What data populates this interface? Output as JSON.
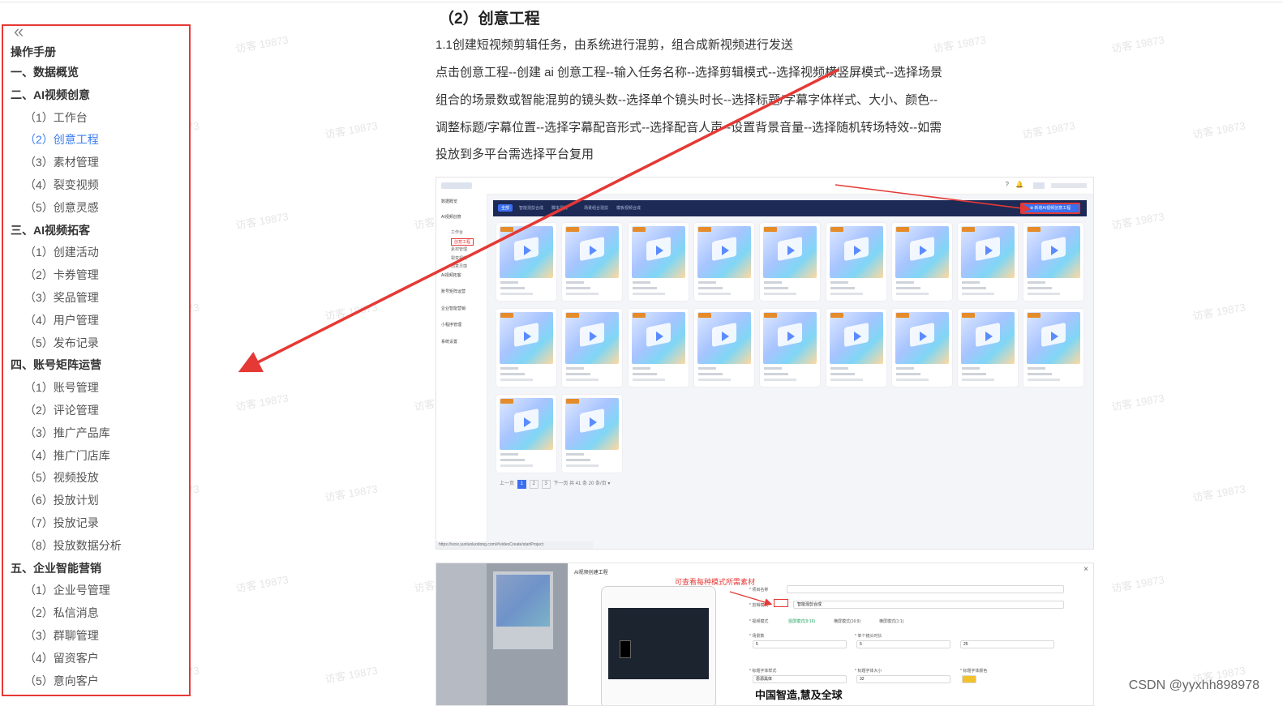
{
  "toc": {
    "collapse_glyph": "«",
    "title": "操作手册",
    "items": [
      {
        "label": "一、数据概览",
        "level": 1
      },
      {
        "label": "二、AI视频创意",
        "level": 1
      },
      {
        "label": "（1）工作台",
        "level": 2
      },
      {
        "label": "（2）创意工程",
        "level": 2,
        "active": true
      },
      {
        "label": "（3）素材管理",
        "level": 2
      },
      {
        "label": "（4）裂变视频",
        "level": 2
      },
      {
        "label": "（5）创意灵感",
        "level": 2
      },
      {
        "label": "三、AI视频拓客",
        "level": 1
      },
      {
        "label": "（1）创建活动",
        "level": 2
      },
      {
        "label": "（2）卡券管理",
        "level": 2
      },
      {
        "label": "（3）奖品管理",
        "level": 2
      },
      {
        "label": "（4）用户管理",
        "level": 2
      },
      {
        "label": "（5）发布记录",
        "level": 2
      },
      {
        "label": "四、账号矩阵运营",
        "level": 1
      },
      {
        "label": "（1）账号管理",
        "level": 2
      },
      {
        "label": "（2）评论管理",
        "level": 2
      },
      {
        "label": "（3）推广产品库",
        "level": 2
      },
      {
        "label": "（4）推广门店库",
        "level": 2
      },
      {
        "label": "（5）视频投放",
        "level": 2
      },
      {
        "label": "（6）投放计划",
        "level": 2
      },
      {
        "label": "（7）投放记录",
        "level": 2
      },
      {
        "label": "（8）投放数据分析",
        "level": 2
      },
      {
        "label": "五、企业智能营销",
        "level": 1
      },
      {
        "label": "（1）企业号管理",
        "level": 2
      },
      {
        "label": "（2）私信消息",
        "level": 2
      },
      {
        "label": "（3）群聊管理",
        "level": 2
      },
      {
        "label": "（4）留资客户",
        "level": 2
      },
      {
        "label": "（5）意向客户",
        "level": 2
      }
    ]
  },
  "article": {
    "heading": "（2）创意工程",
    "paragraphs": [
      "1.1创建短视频剪辑任务，由系统进行混剪，组合成新视频进行发送",
      "点击创意工程--创建 ai 创意工程--输入任务名称--选择剪辑模式--选择视频横竖屏模式--选择场景",
      "组合的场景数或智能混剪的镜头数--选择单个镜头时长--选择标题/字幕字体样式、大小、颜色--",
      "调整标题/字幕位置--选择字幕配音形式--选择配音人声--设置背景音量--选择随机转场特效--如需",
      "投放到多平台需选择平台复用"
    ]
  },
  "shot1": {
    "help_glyph": "?",
    "menu": [
      {
        "label": "数据概览",
        "sub": false
      },
      {
        "label": "AI视频创意",
        "sub": false
      },
      {
        "label": "工作台",
        "sub": true
      },
      {
        "label": "创意工程",
        "sub": true,
        "highlight": true
      },
      {
        "label": "素材管理",
        "sub": true
      },
      {
        "label": "裂变视频",
        "sub": true
      },
      {
        "label": "创意灵感",
        "sub": true
      },
      {
        "label": "AI视频拓客",
        "sub": false
      },
      {
        "label": "账号矩阵运营",
        "sub": false
      },
      {
        "label": "企业智能营销",
        "sub": false
      },
      {
        "label": "小程序管理",
        "sub": false
      },
      {
        "label": "系统设置",
        "sub": false
      }
    ],
    "tabs": [
      "全部",
      "智能混剪合成",
      "脚本混剪",
      "场景组合混剪",
      "模板视频合成"
    ],
    "create_button": "⊕ 新增AI视频创意工程",
    "pager": {
      "prev": "上一页",
      "pages": [
        "1",
        "2",
        "3"
      ],
      "next": "下一页",
      "total": "共 41 条",
      "size": "20 条/页 ▾"
    },
    "url": "https://xxxx.yunluoluodong.com/#/videoCreate/startProject"
  },
  "shot2": {
    "dialog_title": "AI视频创建工程",
    "close_glyph": "×",
    "hint_text": "可查看每种模式所需素材",
    "labels": [
      "* 项目名称",
      "* 剪辑模式",
      "* 视频模式",
      "* 场景数",
      "* 单个镜头时长",
      "* 标题字体样式",
      "* 标题字体大小",
      "* 标题字体颜色"
    ],
    "values": [
      "智能混剪合成",
      "5",
      "5",
      "25",
      "32"
    ],
    "radio": [
      "竖屏模式(9:16)",
      "横屏模式(16:9)",
      "横屏模式(1:1)"
    ],
    "font_value": "思源黑体",
    "slogan": "中国智造,慧及全球"
  },
  "credit": "CSDN @yyxhh898978",
  "watermark": "访客 19873",
  "colors": {
    "accent": "#3b7df0",
    "annotation_red": "#e53935",
    "banner": "#1d2a56"
  }
}
